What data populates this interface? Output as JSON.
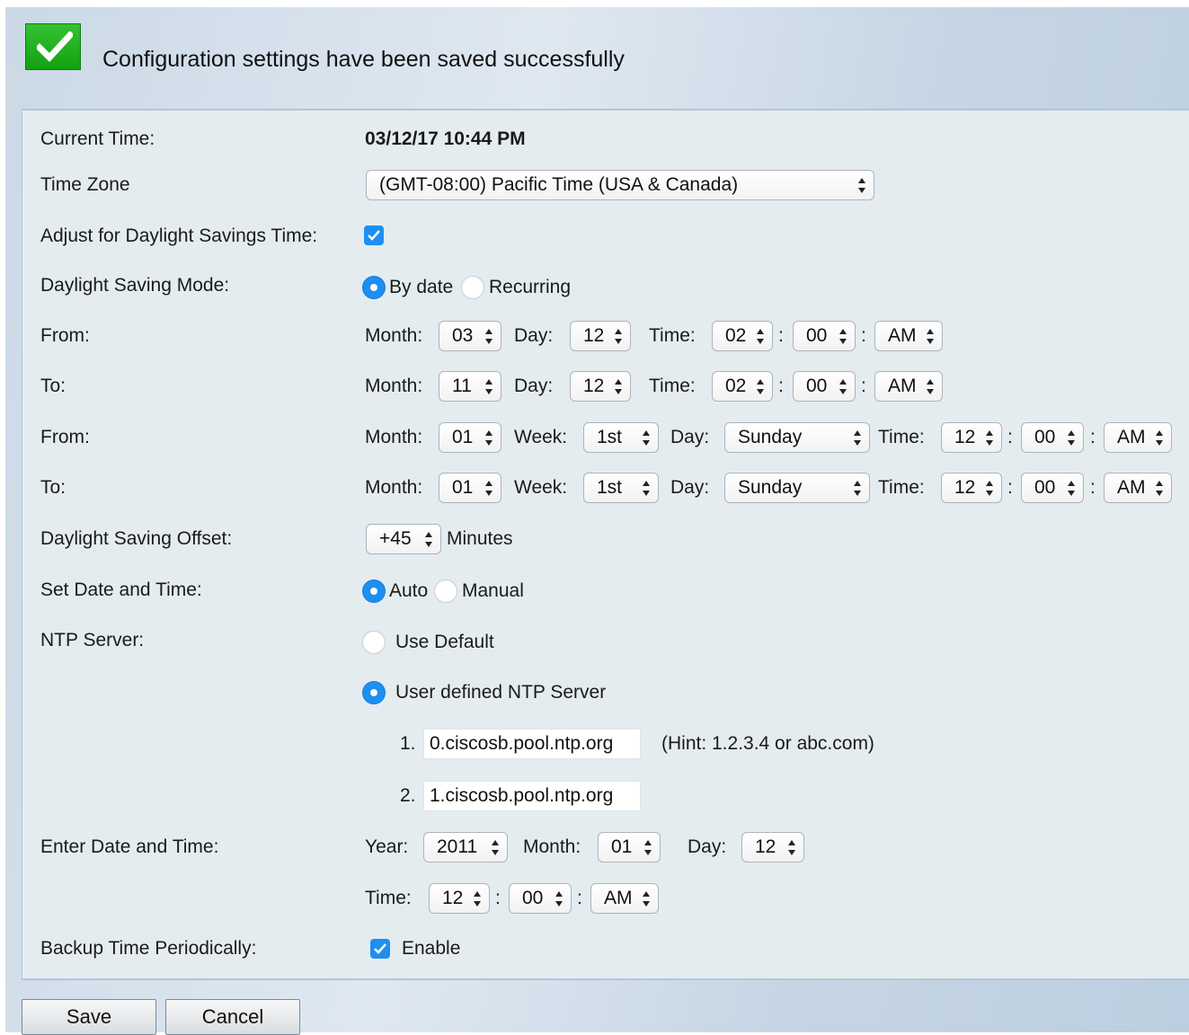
{
  "banner": {
    "message": "Configuration settings have been saved successfully",
    "icon": "checkmark-icon",
    "icon_color": "#1ca61a"
  },
  "current_time": {
    "label": "Current Time:",
    "value": "03/12/17 10:44 PM"
  },
  "time_zone": {
    "label": "Time Zone",
    "value": "(GMT-08:00) Pacific Time (USA & Canada)"
  },
  "dst_adjust": {
    "label": "Adjust for Daylight Savings Time:",
    "checked": true
  },
  "dst_mode": {
    "label": "Daylight Saving Mode:",
    "option_by_date": "By date",
    "option_recurring": "Recurring",
    "selected": "By date"
  },
  "labels": {
    "from": "From:",
    "to": "To:",
    "month": "Month:",
    "day": "Day:",
    "time": "Time:",
    "week": "Week:",
    "colon": ":",
    "year": "Year:",
    "minutes": "Minutes",
    "hint": "(Hint: 1.2.3.4 or abc.com)",
    "n1": "1.",
    "n2": "2."
  },
  "by_date_from": {
    "month": "03",
    "day": "12",
    "hour": "02",
    "minute": "00",
    "ampm": "AM"
  },
  "by_date_to": {
    "month": "11",
    "day": "12",
    "hour": "02",
    "minute": "00",
    "ampm": "AM"
  },
  "recurring_from": {
    "month": "01",
    "week": "1st",
    "day": "Sunday",
    "hour": "12",
    "minute": "00",
    "ampm": "AM"
  },
  "recurring_to": {
    "month": "01",
    "week": "1st",
    "day": "Sunday",
    "hour": "12",
    "minute": "00",
    "ampm": "AM"
  },
  "offset": {
    "label": "Daylight Saving Offset:",
    "value": "+45"
  },
  "set_date_time": {
    "label": "Set Date and Time:",
    "option_auto": "Auto",
    "option_manual": "Manual",
    "selected": "Auto"
  },
  "ntp": {
    "label": "NTP Server:",
    "option_default": "Use Default",
    "option_user": "User defined NTP Server",
    "selected": "User defined NTP Server",
    "server1": "0.ciscosb.pool.ntp.org",
    "server2": "1.ciscosb.pool.ntp.org"
  },
  "manual_entry": {
    "label": "Enter Date and Time:",
    "year": "2011",
    "month": "01",
    "day": "12",
    "hour": "12",
    "minute": "00",
    "ampm": "AM"
  },
  "backup": {
    "label": "Backup Time Periodically:",
    "option": "Enable",
    "checked": true
  },
  "buttons": {
    "save": "Save",
    "cancel": "Cancel"
  },
  "colors": {
    "accent": "#1e8ff0",
    "panel_bg": "#e5ecf0"
  }
}
